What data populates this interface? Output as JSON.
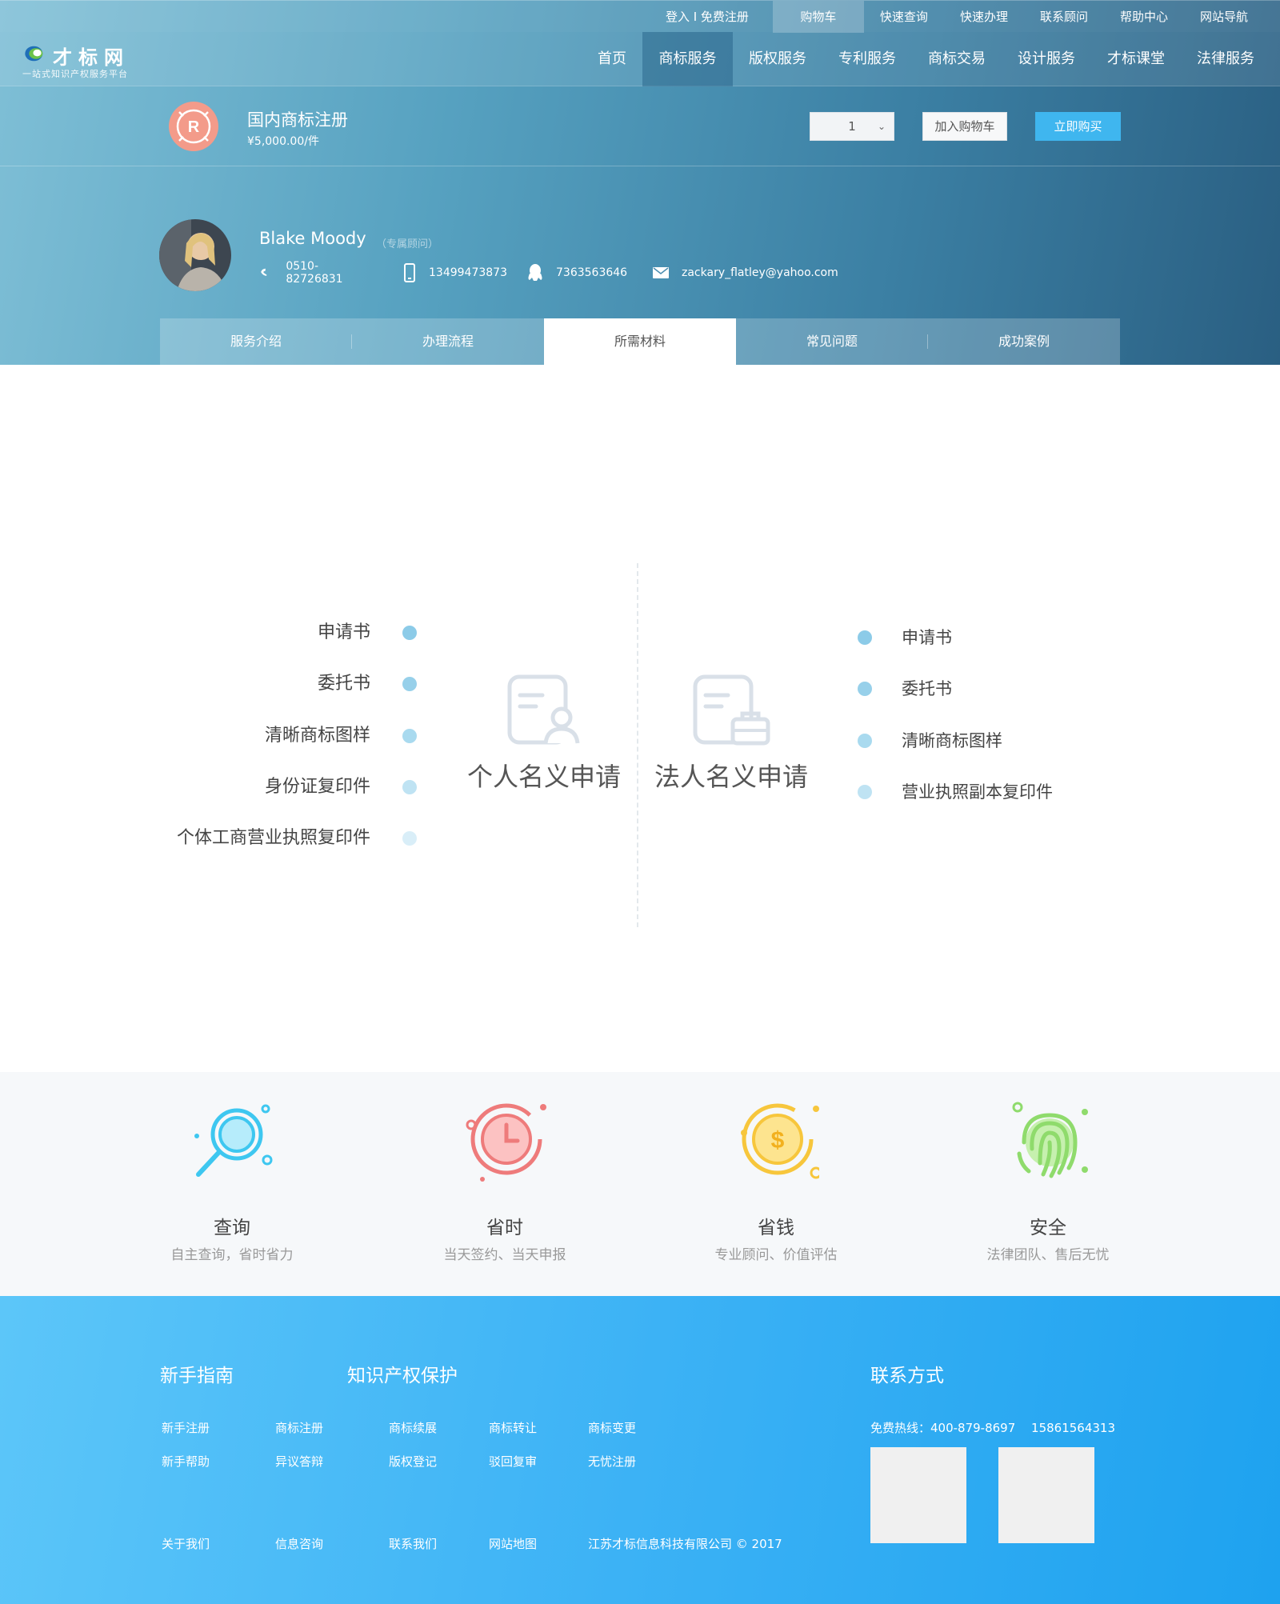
{
  "topbar": {
    "links": [
      "登入 I 免费注册",
      "购物车",
      "快速查询",
      "快速办理",
      "联系顾问",
      "帮助中心",
      "网站导航"
    ],
    "active_index": 1
  },
  "logo": {
    "name": "才标网",
    "tagline": "一站式知识产权服务平台"
  },
  "nav": {
    "links": [
      "首页",
      "商标服务",
      "版权服务",
      "专利服务",
      "商标交易",
      "设计服务",
      "才标课堂",
      "法律服务"
    ],
    "active_index": 1
  },
  "product": {
    "badge_letter": "R",
    "title": "国内商标注册",
    "price": "¥5,000.00/件",
    "quantity": "1",
    "add_to_cart": "加入购物车",
    "buy_now": "立即购买"
  },
  "advisor": {
    "name": "Blake Moody",
    "role": "（专属顾问）",
    "phone": "0510-82726831",
    "mobile": "13499473873",
    "qq": "7363563646",
    "email": "zackary_flatley@yahoo.com"
  },
  "tabs": {
    "items": [
      "服务介绍",
      "办理流程",
      "所需材料",
      "常见问题",
      "成功案例"
    ],
    "active_index": 2
  },
  "materials": {
    "personal": {
      "label": "个人名义申请",
      "items": [
        "申请书",
        "委托书",
        "清晰商标图样",
        "身份证复印件",
        "个体工商营业执照复印件"
      ]
    },
    "corporate": {
      "label": "法人名义申请",
      "items": [
        "申请书",
        "委托书",
        "清晰商标图样",
        "营业执照副本复印件"
      ]
    },
    "dot_colors": [
      "#8ccbe8",
      "#97d0ea",
      "#a9daef",
      "#bfe3f3",
      "#d9eef8"
    ]
  },
  "features": [
    {
      "title": "查询",
      "desc": "自主查询，省时省力",
      "icon": "magnifier-icon",
      "color": "#3ec7f0"
    },
    {
      "title": "省时",
      "desc": "当天签约、当天申报",
      "icon": "clock-icon",
      "color": "#ee7b7b"
    },
    {
      "title": "省钱",
      "desc": "专业顾问、价值评估",
      "icon": "coin-icon",
      "color": "#f7c63c"
    },
    {
      "title": "安全",
      "desc": "法律团队、售后无忧",
      "icon": "fingerprint-icon",
      "color": "#8fdb6c"
    }
  ],
  "footer": {
    "guide_title": "新手指南",
    "ip_title": "知识产权保护",
    "contact_title": "联系方式",
    "guide_links": [
      "新手注册",
      "新手帮助"
    ],
    "ip_links_row1": [
      "商标注册",
      "商标续展",
      "商标转让",
      "商标变更"
    ],
    "ip_links_row2": [
      "异议答辩",
      "版权登记",
      "驳回复审",
      "无忧注册"
    ],
    "hotline": "免费热线：400-879-8697　 15861564313",
    "bottom_links": [
      "关于我们",
      "信息咨询",
      "联系我们",
      "网站地图"
    ],
    "copyright": "江苏才标信息科技有限公司 © 2017"
  }
}
